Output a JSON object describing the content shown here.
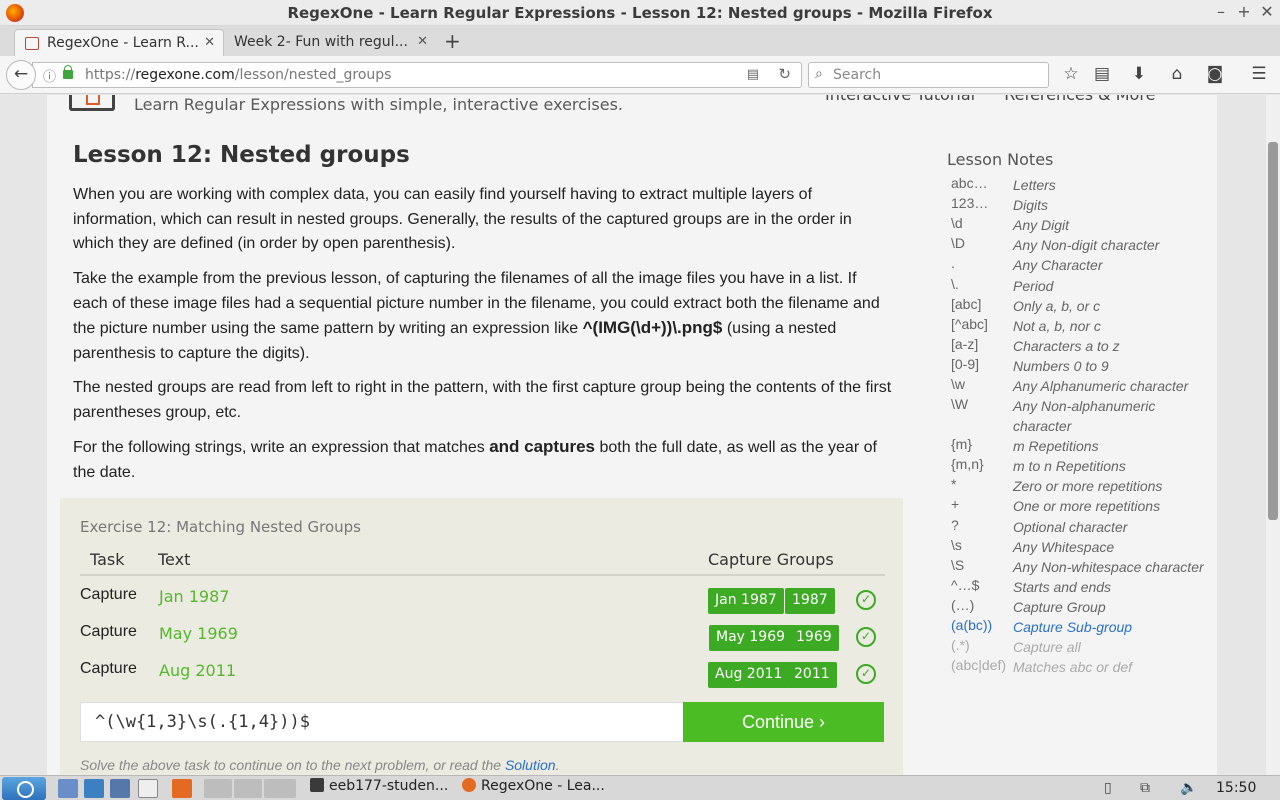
{
  "window": {
    "title": "RegexOne - Learn Regular Expressions - Lesson 12: Nested groups - Mozilla Firefox"
  },
  "tabs": [
    {
      "label": "RegexOne - Learn R...",
      "active": true
    },
    {
      "label": "Week 2- Fun with regul...",
      "active": false
    }
  ],
  "nav": {
    "url_prefix": "https://",
    "url_domain": "regexone.com",
    "url_path": "/lesson/nested_groups",
    "search_placeholder": "Search"
  },
  "site": {
    "tagline": "Learn Regular Expressions with simple, interactive exercises.",
    "link_tutorial": "Interactive Tutorial",
    "link_references": "References & More"
  },
  "lesson": {
    "title": "Lesson 12: Nested groups",
    "p1": "When you are working with complex data, you can easily find yourself having to extract multiple layers of information, which can result in nested groups. Generally, the results of the captured groups are in the order in which they are defined (in order by open parenthesis).",
    "p2_a": "Take the example from the previous lesson, of capturing the filenames of all the image files you have in a list. If each of these image files had a sequential picture number in the filename, you could extract both the filename and the picture number using the same pattern by writing an expression like ",
    "p2_code": "^(IMG(\\d+))\\.png$",
    "p2_b": " (using a nested parenthesis to capture the digits).",
    "p3": "The nested groups are read from left to right in the pattern, with the first capture group being the contents of the first parentheses group, etc.",
    "p4_a": "For the following strings, write an expression that matches ",
    "p4_strong": "and captures",
    "p4_b": " both the full date, as well as the year of the date."
  },
  "exercise": {
    "title": "Exercise 12: Matching Nested Groups",
    "headers": {
      "task": "Task",
      "text": "Text",
      "groups": "Capture Groups"
    },
    "rows": [
      {
        "task": "Capture",
        "text": "Jan 1987",
        "g1": "Jan 1987",
        "g2": "1987"
      },
      {
        "task": "Capture",
        "text": "May 1969",
        "g1": "May 1969",
        "g2": "1969"
      },
      {
        "task": "Capture",
        "text": "Aug 2011",
        "g1": "Aug 2011",
        "g2": "2011"
      }
    ],
    "input_value": "^(\\w{1,3}\\s(.{1,4}))$",
    "continue_label": "Continue ›",
    "hint_a": "Solve the above task to continue on to the next problem, or read the ",
    "hint_link": "Solution",
    "hint_b": "."
  },
  "notes": {
    "title": "Lesson Notes",
    "items": [
      {
        "k": "abc…",
        "v": "Letters"
      },
      {
        "k": "123…",
        "v": "Digits"
      },
      {
        "k": "\\d",
        "v": "Any Digit"
      },
      {
        "k": "\\D",
        "v": "Any Non-digit character"
      },
      {
        "k": ".",
        "v": "Any Character"
      },
      {
        "k": "\\.",
        "v": "Period"
      },
      {
        "k": "[abc]",
        "v": "Only a, b, or c"
      },
      {
        "k": "[^abc]",
        "v": "Not a, b, nor c"
      },
      {
        "k": "[a-z]",
        "v": "Characters a to z"
      },
      {
        "k": "[0-9]",
        "v": "Numbers 0 to 9"
      },
      {
        "k": "\\w",
        "v": "Any Alphanumeric character"
      },
      {
        "k": "\\W",
        "v": "Any Non-alphanumeric character"
      },
      {
        "k": "{m}",
        "v": "m Repetitions"
      },
      {
        "k": "{m,n}",
        "v": "m to n Repetitions"
      },
      {
        "k": "*",
        "v": "Zero or more repetitions"
      },
      {
        "k": "+",
        "v": "One or more repetitions"
      },
      {
        "k": "?",
        "v": "Optional character"
      },
      {
        "k": "\\s",
        "v": "Any Whitespace"
      },
      {
        "k": "\\S",
        "v": "Any Non-whitespace character"
      },
      {
        "k": "^…$",
        "v": "Starts and ends"
      },
      {
        "k": "(…)",
        "v": "Capture Group"
      },
      {
        "k": "(a(bc))",
        "v": "Capture Sub-group"
      },
      {
        "k": "(.*)",
        "v": "Capture all"
      },
      {
        "k": "(abc|def)",
        "v": "Matches abc or def"
      }
    ]
  },
  "taskbar": {
    "task1": "eeb177-studen...",
    "task2": "RegexOne - Lea...",
    "clock": "15:50"
  },
  "colors": {
    "accent_green": "#4cbc24",
    "text_green": "#55b82a",
    "link_blue": "#2a6fc9"
  }
}
